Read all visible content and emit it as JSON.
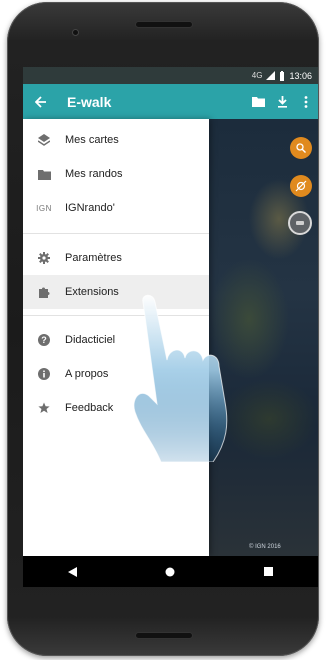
{
  "status_bar": {
    "time": "13:06",
    "network_label": "4G"
  },
  "app_bar": {
    "title": "E-walk"
  },
  "drawer": {
    "items": [
      {
        "label": "Mes cartes",
        "icon": "layers-icon"
      },
      {
        "label": "Mes randos",
        "icon": "folder-icon"
      },
      {
        "label": "IGNrando'",
        "icon": "ign-icon",
        "icon_text": "IGN"
      },
      {
        "label": "Paramètres",
        "icon": "gear-icon"
      },
      {
        "label": "Extensions",
        "icon": "puzzle-icon",
        "selected": true
      },
      {
        "label": "Didacticiel",
        "icon": "help-icon"
      },
      {
        "label": "A propos",
        "icon": "info-icon"
      },
      {
        "label": "Feedback",
        "icon": "star-icon"
      }
    ]
  },
  "map": {
    "credit": "© IGN 2016"
  },
  "colors": {
    "accent": "#2ba3a8",
    "status_bar": "#2f3b3b",
    "fab_orange": "#e08a1e",
    "selected_row": "#eeeeee"
  }
}
